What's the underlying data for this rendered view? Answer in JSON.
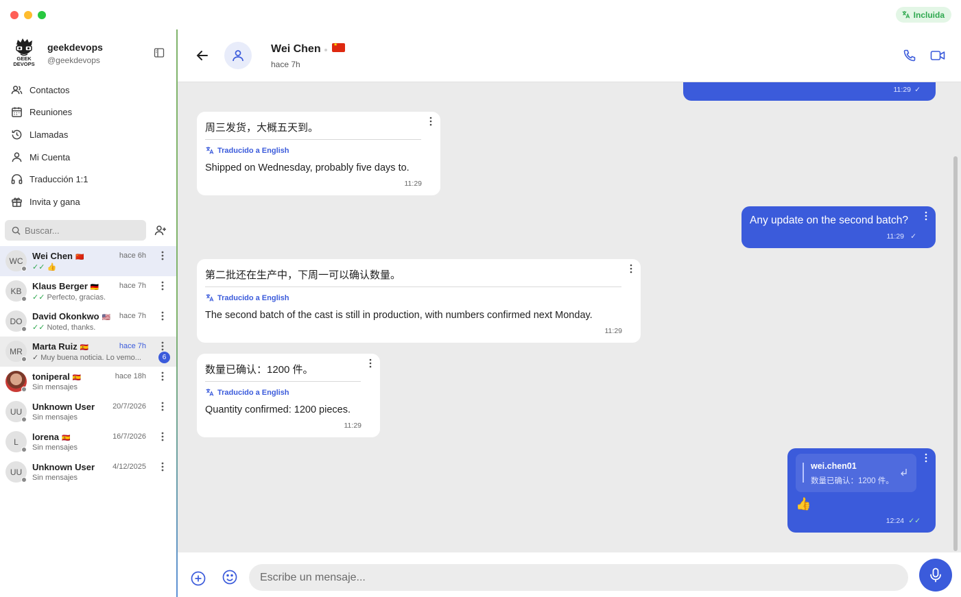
{
  "window": {
    "badge_label": "Incluida"
  },
  "profile": {
    "logo_text_1": "GEEK",
    "logo_text_2": "DEVOPS",
    "name": "geekdevops",
    "handle": "@geekdevops"
  },
  "nav": [
    {
      "label": "Contactos",
      "icon": "contacts-icon"
    },
    {
      "label": "Reuniones",
      "icon": "calendar-icon"
    },
    {
      "label": "Llamadas",
      "icon": "history-icon"
    },
    {
      "label": "Mi Cuenta",
      "icon": "user-icon"
    },
    {
      "label": "Traducción 1:1",
      "icon": "headset-icon"
    },
    {
      "label": "Invita y gana",
      "icon": "gift-icon"
    }
  ],
  "search": {
    "placeholder": "Buscar..."
  },
  "contacts": [
    {
      "initials": "WC",
      "name": "Wei Chen",
      "flag": "🇨🇳",
      "preview": "👍",
      "time": "hace 6h",
      "ticks": "✓✓"
    },
    {
      "initials": "KB",
      "name": "Klaus Berger",
      "flag": "🇩🇪",
      "preview": "Perfecto, gracias.",
      "time": "hace 7h",
      "ticks": "✓✓"
    },
    {
      "initials": "DO",
      "name": "David Okonkwo",
      "flag": "🇺🇸",
      "preview": "Noted, thanks.",
      "time": "hace 7h",
      "ticks": "✓✓"
    },
    {
      "initials": "MR",
      "name": "Marta Ruiz",
      "flag": "🇪🇸",
      "preview": "Muy buena noticia. Lo vemo...",
      "time": "hace 7h",
      "ticks": "✓",
      "unread": "6"
    },
    {
      "initials": "",
      "name": "toniperal",
      "flag": "🇪🇸",
      "preview": "Sin mensajes",
      "time": "hace 18h"
    },
    {
      "initials": "UU",
      "name": "Unknown User",
      "flag": "",
      "preview": "Sin mensajes",
      "time": "20/7/2026"
    },
    {
      "initials": "L",
      "name": "lorena",
      "flag": "🇪🇸",
      "preview": "Sin mensajes",
      "time": "16/7/2026"
    },
    {
      "initials": "UU",
      "name": "Unknown User",
      "flag": "",
      "preview": "Sin mensajes",
      "time": "4/12/2025"
    }
  ],
  "chat": {
    "name": "Wei Chen",
    "status": "hace 7h",
    "flag_color": "#de2910"
  },
  "messages": {
    "m0": {
      "time": "11:29",
      "ticks": "✓"
    },
    "m1": {
      "original": "周三发货，大概五天到。",
      "translation_label": "Traducido a English",
      "translation": "Shipped on Wednesday, probably five days to.",
      "time": "11:29"
    },
    "m2": {
      "text": "Any update on the second batch?",
      "time": "11:29",
      "ticks": "✓"
    },
    "m3": {
      "original": "第二批还在生产中，下周一可以确认数量。",
      "translation_label": "Traducido a English",
      "translation": "The second batch of the cast is still in production, with numbers confirmed next Monday.",
      "time": "11:29"
    },
    "m4": {
      "original": "数量已确认：1200 件。",
      "translation_label": "Traducido a English",
      "translation": "Quantity confirmed: 1200 pieces.",
      "time": "11:29"
    },
    "m5": {
      "reply_author": "wei.chen01",
      "reply_text": "数量已确认：1200 件。",
      "text": "👍",
      "time": "12:24",
      "ticks": "✓✓"
    }
  },
  "composer": {
    "placeholder": "Escribe un mensaje..."
  },
  "colors": {
    "accent": "#3b5bdb",
    "included_green": "#2fa84f",
    "chat_bg": "#ebebeb"
  }
}
